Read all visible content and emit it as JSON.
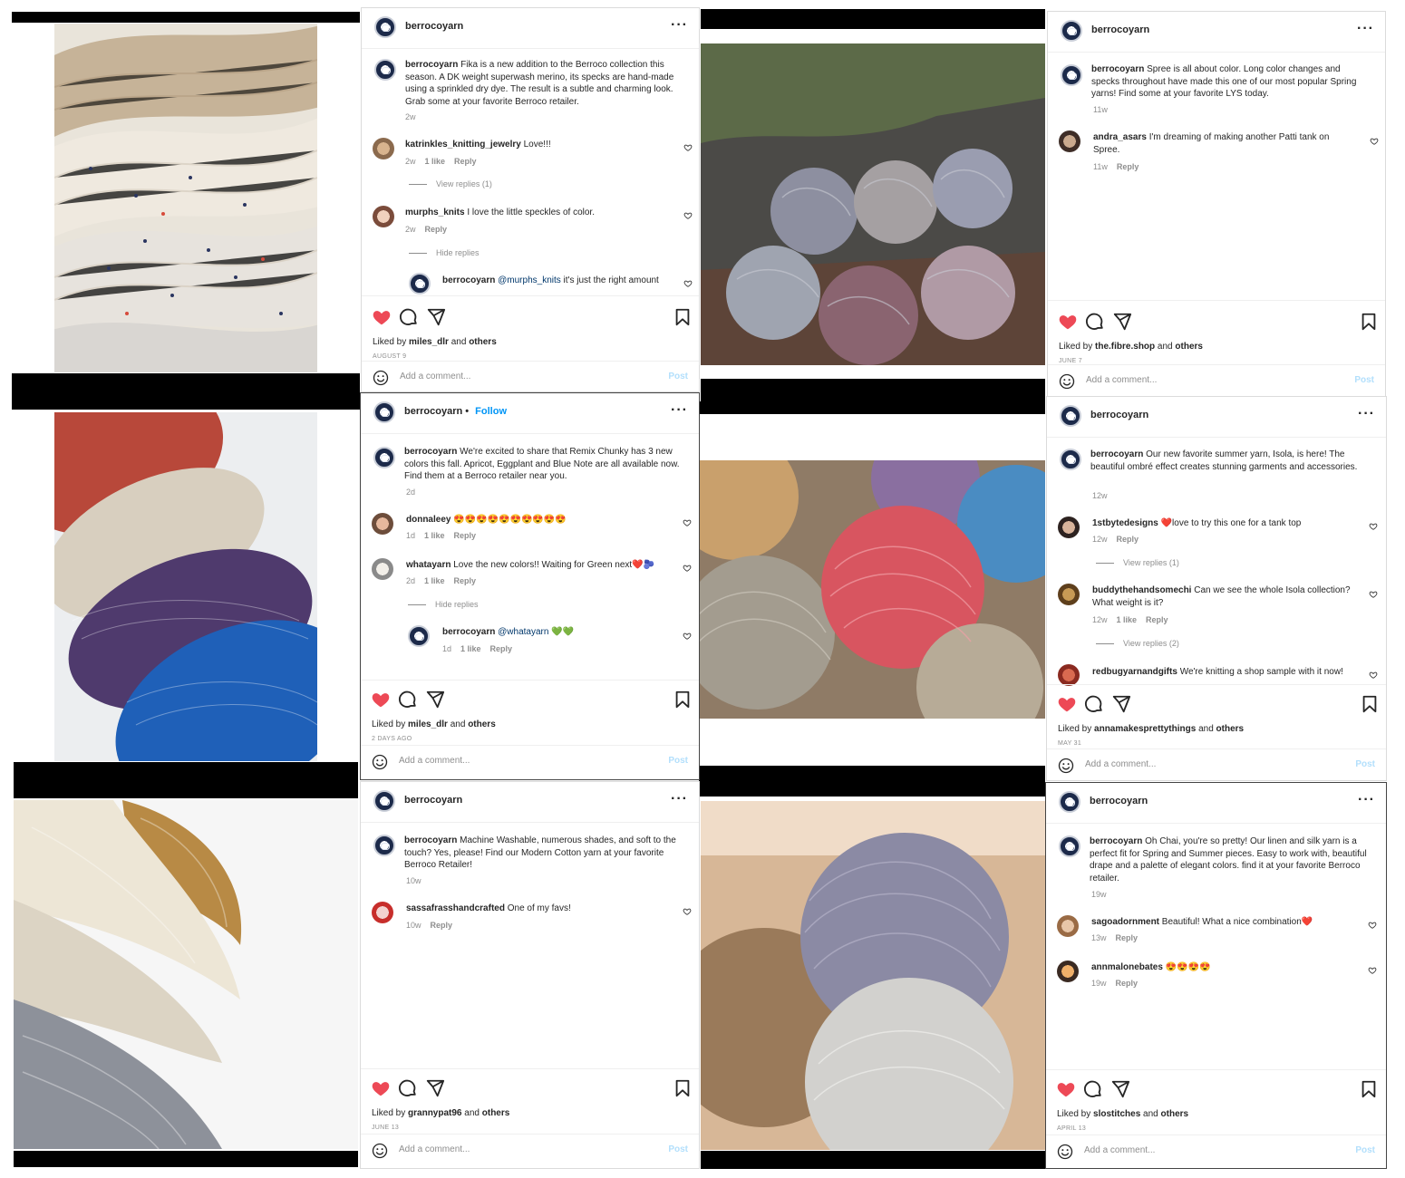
{
  "account": "berrocoyarn",
  "ui": {
    "follow": "Follow",
    "view_replies_1": "View replies (1)",
    "view_replies_2": "View replies (2)",
    "hide_replies": "Hide replies",
    "reply": "Reply",
    "add_comment": "Add a comment...",
    "post": "Post",
    "liked_by": "Liked by",
    "and_others": "and others",
    "others": "others"
  },
  "colors": {
    "heart": "#ed4956",
    "link": "#0095f6",
    "post_disabled": "#b2dffc"
  },
  "posts": [
    {
      "caption": "Fika is a new addition to the Berroco collection this season. A DK weight superwash merino, its specks are hand-made using a sprinkled dry dye. The result is a subtle and charming look. Grab some at your favorite Berroco retailer.",
      "caption_time": "2w",
      "comments": [
        {
          "user": "katrinkles_knitting_jewelry",
          "text": "Love!!!",
          "time": "2w",
          "likes": "1 like"
        },
        {
          "user": "murphs_knits",
          "text": "I love the little speckles of color.",
          "time": "2w"
        },
        {
          "user": "berrocoyarn",
          "mention": "@murphs_knits",
          "text": "it's just the right amount"
        }
      ],
      "liked_user": "miles_dlr",
      "date": "AUGUST 9"
    },
    {
      "caption": "Spree is all about color. Long color changes and specks throughout have made this one of our most popular Spring yarns! Find some at your favorite LYS today.",
      "caption_time": "11w",
      "comments": [
        {
          "user": "andra_asars",
          "text": "I'm dreaming of making another Patti tank on Spree.",
          "time": "11w"
        }
      ],
      "liked_user": "the.fibre.shop",
      "date": "JUNE 7"
    },
    {
      "caption": "We're excited to share that Remix Chunky has 3 new colors this fall. Apricot, Eggplant and Blue Note are all available now. Find them at a Berroco retailer near you.",
      "caption_time": "2d",
      "comments": [
        {
          "user": "donnaleey",
          "text": "😍😍😍😍😍😍😍😍😍😍",
          "time": "1d",
          "likes": "1 like"
        },
        {
          "user": "whatayarn",
          "text": "Love the new colors!! Waiting for Green next❤️🫐",
          "time": "2d",
          "likes": "1 like"
        },
        {
          "user": "berrocoyarn",
          "mention": "@whatayarn",
          "text": "💚💚",
          "time": "1d",
          "likes": "1 like"
        }
      ],
      "liked_user": "miles_dlr",
      "date": "2 DAYS AGO"
    },
    {
      "caption": "Our new favorite summer yarn, Isola, is here! The beautiful ombré effect creates stunning garments and accessories.",
      "caption_time": "12w",
      "comments": [
        {
          "user": "1stbytedesigns",
          "text": "❤️love to try this one for a tank top",
          "time": "12w"
        },
        {
          "user": "buddythehandsomechi",
          "text": "Can we see the whole Isola collection? What weight is it?",
          "time": "12w",
          "likes": "1 like"
        },
        {
          "user": "redbugyarnandgifts",
          "text": "We're knitting a shop sample with it now!"
        }
      ],
      "liked_user": "annamakesprettythings",
      "date": "MAY 31"
    },
    {
      "caption": "Machine Washable, numerous shades, and soft to the touch? Yes, please! Find our Modern Cotton yarn at your favorite Berroco Retailer!",
      "caption_time": "10w",
      "comments": [
        {
          "user": "sassafrasshandcrafted",
          "text": "One of my favs!",
          "time": "10w"
        }
      ],
      "liked_user": "grannypat96",
      "date": "JUNE 13"
    },
    {
      "caption": "Oh Chai, you're so pretty! Our linen and silk yarn is a perfect fit for Spring and Summer pieces. Easy to work with, beautiful drape and a palette of elegant colors. find it at your favorite Berroco retailer.",
      "caption_time": "19w",
      "comments": [
        {
          "user": "sagoadornment",
          "text": "Beautiful! What a nice combination❤️",
          "time": "13w"
        },
        {
          "user": "annmalonebates",
          "text": "😍😍😍😍",
          "time": "19w"
        }
      ],
      "liked_user": "slostitches",
      "date": "APRIL 13"
    }
  ]
}
